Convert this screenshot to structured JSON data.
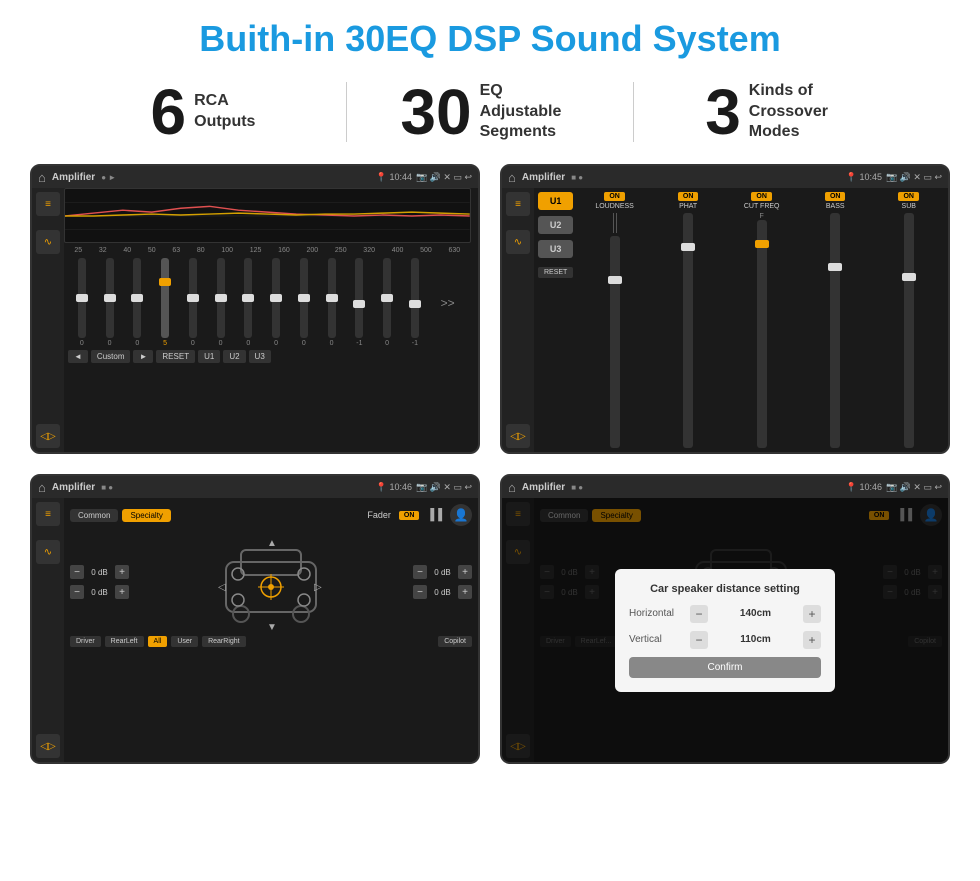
{
  "header": {
    "title": "Buith-in 30EQ DSP Sound System"
  },
  "stats": [
    {
      "number": "6",
      "label": "RCA\nOutputs"
    },
    {
      "number": "30",
      "label": "EQ Adjustable\nSegments"
    },
    {
      "number": "3",
      "label": "Kinds of\nCrossover Modes"
    }
  ],
  "screens": {
    "eq": {
      "title": "Amplifier",
      "time": "10:44",
      "eq_labels": [
        "25",
        "32",
        "40",
        "50",
        "63",
        "80",
        "100",
        "125",
        "160",
        "200",
        "250",
        "320",
        "400",
        "500",
        "630"
      ],
      "eq_values": [
        "0",
        "0",
        "0",
        "5",
        "0",
        "0",
        "0",
        "0",
        "0",
        "0",
        "-1",
        "0",
        "-1"
      ],
      "buttons": [
        "◄",
        "Custom",
        "►",
        "RESET",
        "U1",
        "U2",
        "U3"
      ]
    },
    "crossover": {
      "title": "Amplifier",
      "time": "10:45",
      "u_buttons": [
        "U1",
        "U2",
        "U3"
      ],
      "channels": [
        "LOUDNESS",
        "PHAT",
        "CUT FREQ",
        "BASS",
        "SUB"
      ],
      "reset_label": "RESET"
    },
    "fader": {
      "title": "Amplifier",
      "time": "10:46",
      "tabs": [
        "Common",
        "Specialty"
      ],
      "fader_label": "Fader",
      "on_label": "ON",
      "db_values": [
        "0 dB",
        "0 dB",
        "0 dB",
        "0 dB"
      ],
      "bottom_btns": [
        "Driver",
        "RearLeft",
        "All",
        "User",
        "RearRight",
        "Copilot"
      ]
    },
    "dialog": {
      "title": "Amplifier",
      "time": "10:46",
      "tabs": [
        "Common",
        "Specialty"
      ],
      "dialog_title": "Car speaker distance setting",
      "horizontal_label": "Horizontal",
      "horizontal_value": "140cm",
      "vertical_label": "Vertical",
      "vertical_value": "110cm",
      "confirm_label": "Confirm",
      "bottom_btns": [
        "Driver",
        "RearLeft",
        "All",
        "User",
        "RearRight",
        "Copilot"
      ]
    }
  },
  "colors": {
    "accent": "#f0a000",
    "blue": "#1a9ae0",
    "dark_bg": "#1a1a1a",
    "panel_bg": "#222"
  }
}
